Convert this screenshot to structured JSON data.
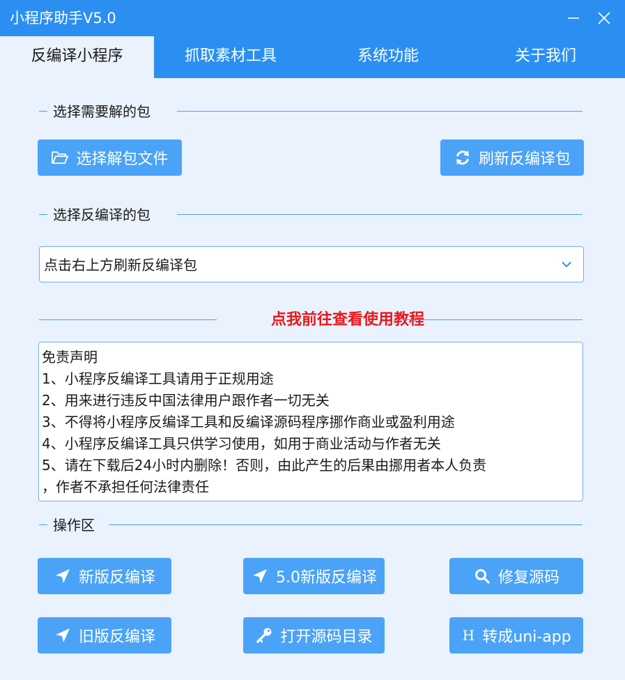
{
  "window": {
    "title": "小程序助手V5.0",
    "minimize_glyph": "—",
    "close_glyph": "✕"
  },
  "tabs": [
    {
      "label": "反编译小程序",
      "active": true
    },
    {
      "label": "抓取素材工具",
      "active": false
    },
    {
      "label": "系统功能",
      "active": false
    },
    {
      "label": "关于我们",
      "active": false
    }
  ],
  "section_select_package": {
    "title": "选择需要解的包",
    "select_file_button": "选择解包文件",
    "refresh_button": "刷新反编译包"
  },
  "section_decompile_package": {
    "title": "选择反编译的包",
    "dropdown_value": "点击右上方刷新反编译包"
  },
  "tutorial_link": "点我前往查看使用教程",
  "disclaimer": {
    "lines": [
      "免责声明",
      " 1、小程序反编译工具请用于正规用途",
      " 2、用来进行违反中国法律用户跟作者一切无关",
      " 3、不得将小程序反编译工具和反编译源码程序挪作商业或盈利用途",
      " 4、小程序反编译工具只供学习使用，如用于商业活动与作者无关",
      " 5、请在下载后24小时内删除！否则，由此产生的后果由挪用者本人负责",
      "，作者不承担任何法律责任"
    ]
  },
  "operations": {
    "title": "操作区",
    "buttons": {
      "new_decompile": "新版反编译",
      "v5_new_decompile": "5.0新版反编译",
      "repair_source": "修复源码",
      "old_decompile": "旧版反编译",
      "open_source_dir": "打开源码目录",
      "convert_uniapp": "转成uni-app",
      "uniapp_icon_letter": "H"
    }
  },
  "colors": {
    "titlebar": "#2b8ff2",
    "background": "#eaf2fd",
    "button": "#4aa3f7",
    "tutorial_link": "#e8171b"
  }
}
